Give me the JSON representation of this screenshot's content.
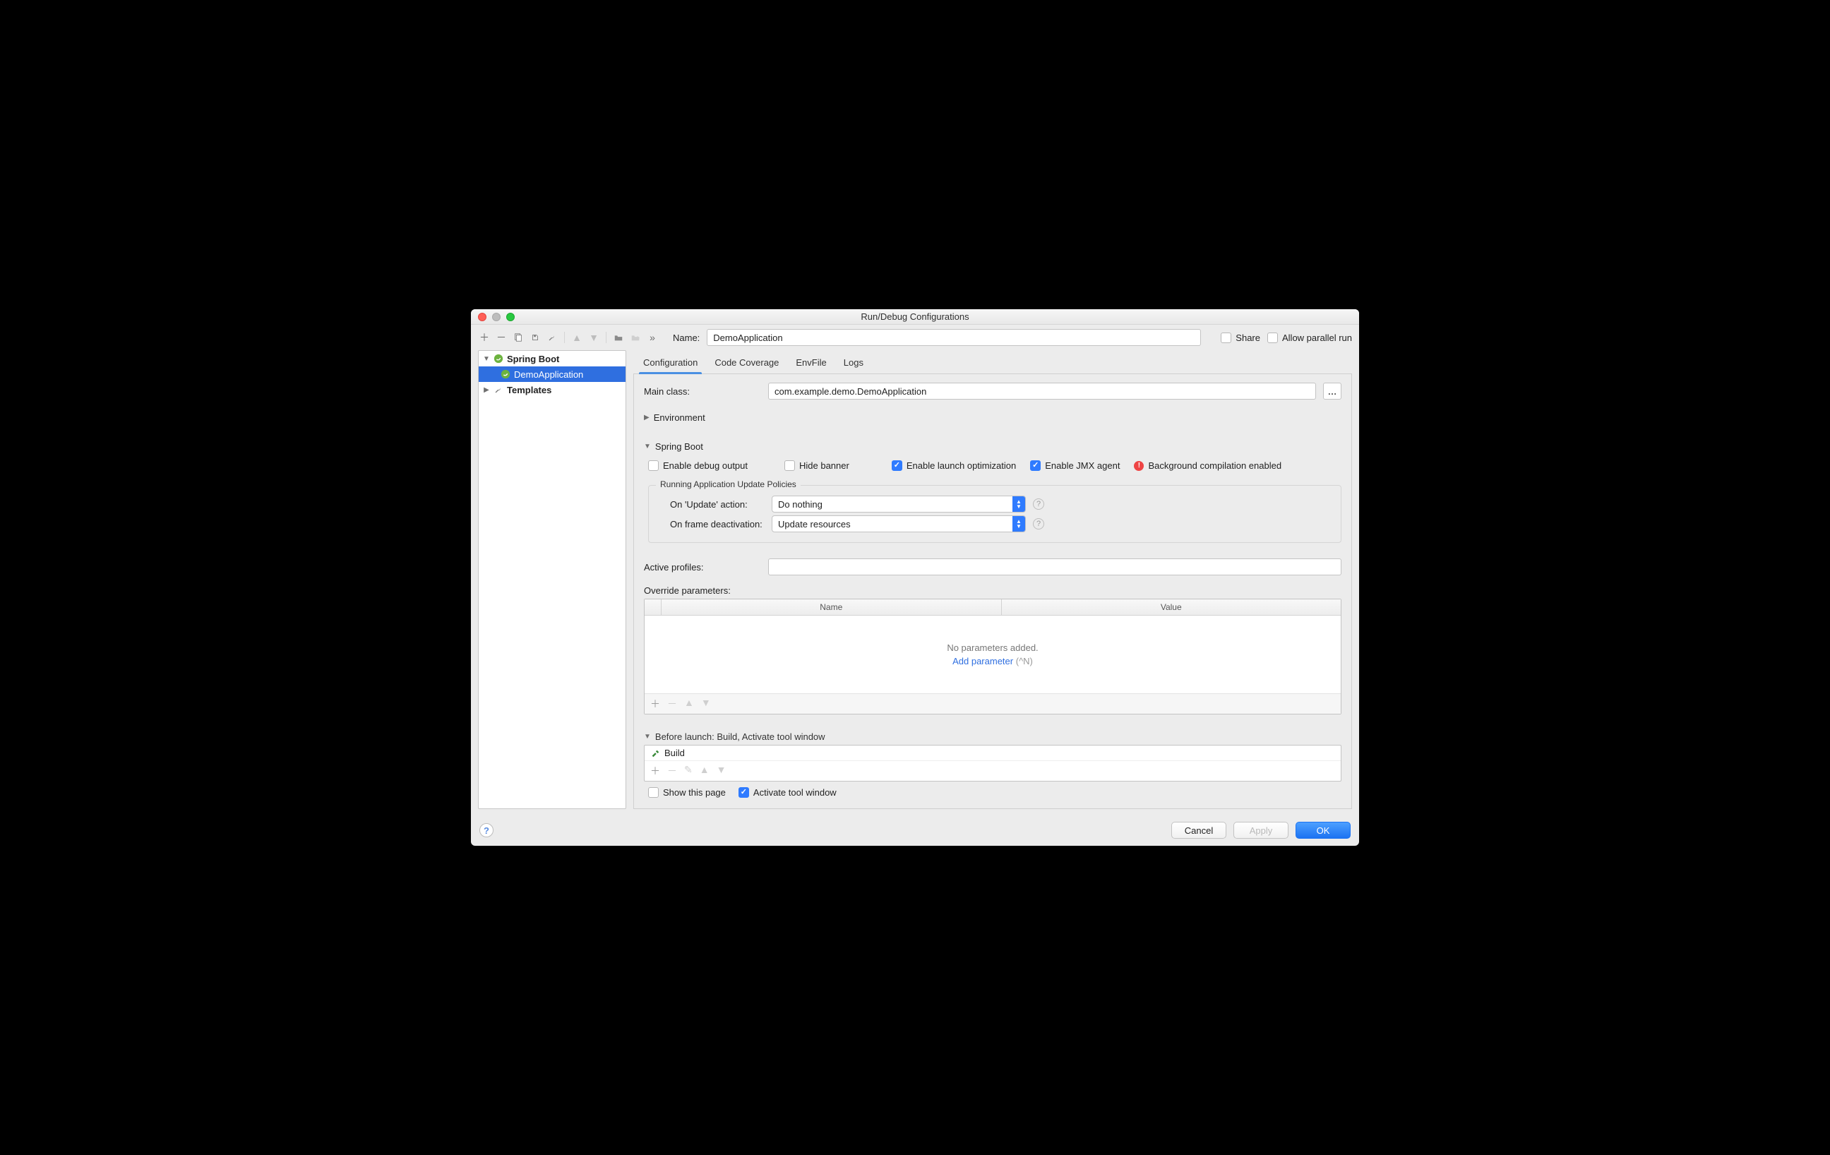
{
  "window": {
    "title": "Run/Debug Configurations"
  },
  "toolbar": {
    "chevrons": "»"
  },
  "name": {
    "label": "Name:",
    "value": "DemoApplication"
  },
  "share": {
    "label": "Share",
    "checked": false
  },
  "parallel": {
    "label": "Allow parallel run",
    "checked": false
  },
  "sidebar": {
    "spring_boot": "Spring Boot",
    "demo": "DemoApplication",
    "templates": "Templates"
  },
  "tabs": {
    "configuration": "Configuration",
    "coverage": "Code Coverage",
    "envfile": "EnvFile",
    "logs": "Logs",
    "active": "configuration"
  },
  "main_class": {
    "label": "Main class:",
    "value": "com.example.demo.DemoApplication"
  },
  "environment": {
    "header": "Environment"
  },
  "spring": {
    "header": "Spring Boot",
    "enable_debug": {
      "label": "Enable debug output",
      "checked": false
    },
    "hide_banner": {
      "label": "Hide banner",
      "checked": false
    },
    "launch_opt": {
      "label": "Enable launch optimization",
      "checked": true
    },
    "jmx": {
      "label": "Enable JMX agent",
      "checked": true
    },
    "bg_compile": {
      "label": "Background compilation enabled"
    },
    "policies": {
      "legend": "Running Application Update Policies",
      "on_update": {
        "label": "On 'Update' action:",
        "value": "Do nothing"
      },
      "on_frame": {
        "label": "On frame deactivation:",
        "value": "Update resources"
      }
    }
  },
  "active_profiles": {
    "label": "Active profiles:",
    "value": ""
  },
  "override": {
    "label": "Override parameters:",
    "col_name": "Name",
    "col_value": "Value",
    "empty": "No parameters added.",
    "add_link": "Add parameter",
    "add_hint": "(^N)"
  },
  "before": {
    "header": "Before launch: Build, Activate tool window",
    "item": "Build",
    "show_page": {
      "label": "Show this page",
      "checked": false
    },
    "activate": {
      "label": "Activate tool window",
      "checked": true
    }
  },
  "footer": {
    "cancel": "Cancel",
    "apply": "Apply",
    "ok": "OK"
  }
}
